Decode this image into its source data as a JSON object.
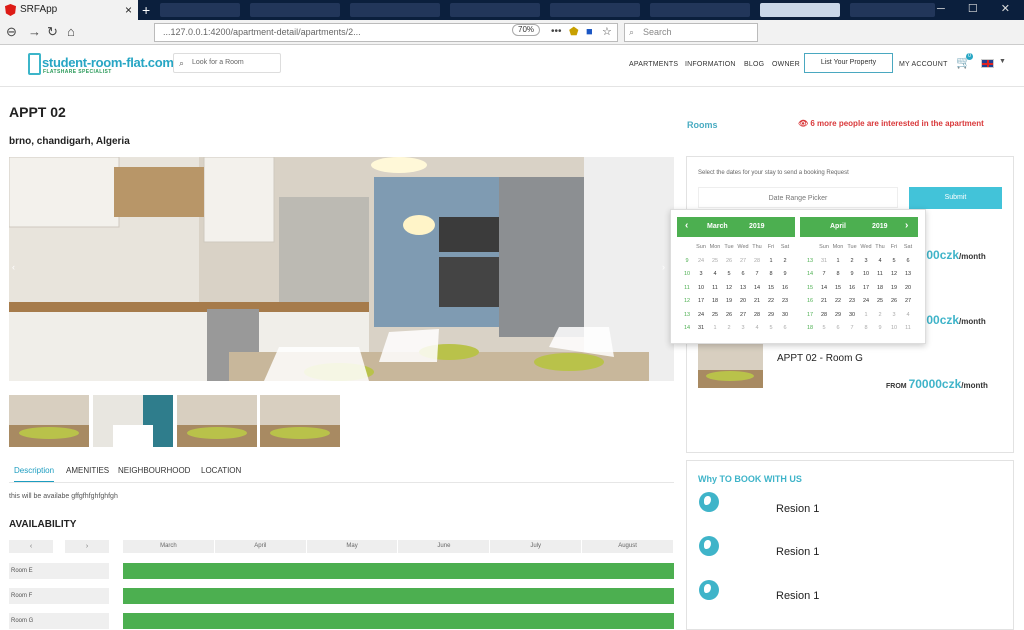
{
  "browser": {
    "tab_title": "SRFApp",
    "tab_close": "×",
    "new_tab": "+",
    "win_buttons": "─ ☐ ✕",
    "url": "...127.0.0.1:4200/apartment-detail/apartments/2...",
    "zoom": "70%",
    "menu_dots": "•••",
    "search_placeholder": "Search"
  },
  "header": {
    "logo": "student-room-flat.com",
    "logo_sub": "FLATSHARE SPECIALIST",
    "search_placeholder": "Look for a Room",
    "nav": [
      "APARTMENTS",
      "INFORMATION",
      "BLOG",
      "OWNER"
    ],
    "list_property": "List Your Property",
    "my_account": "MY ACCOUNT",
    "cart_count": "0"
  },
  "listing": {
    "title": "APPT 02",
    "address": "brno, chandigarh, Algeria",
    "tabs": [
      "Description",
      "AMENITIES",
      "NEIGHBOURHOOD",
      "LOCATION"
    ],
    "description": "this will be availabe gffgfhfghfghfgh"
  },
  "availability": {
    "heading": "AVAILABILITY",
    "prev": "‹",
    "next": "›",
    "months": [
      "March",
      "April",
      "May",
      "June",
      "July",
      "August"
    ],
    "rooms": [
      "Room E",
      "Room F",
      "Room G"
    ]
  },
  "sidebar": {
    "rooms_label": "Rooms",
    "interest": "👁 6 more people are interested in the apartment",
    "hint": "Select the dates for your stay to send a booking Request",
    "date_picker": "Date Range Picker",
    "submit": "Submit",
    "prices": [
      "5000czk",
      "0000czk"
    ],
    "room_g": {
      "name": "APPT 02 - Room G",
      "from": "FROM",
      "price": "70000czk",
      "per": "/month"
    },
    "per_month": "/month"
  },
  "why": {
    "heading": "Why TO BOOK WITH US",
    "reasons": [
      "Resion 1",
      "Resion 1",
      "Resion 1"
    ]
  },
  "calendar": {
    "left": {
      "month": "March",
      "year": "2019",
      "prev": "‹"
    },
    "right": {
      "month": "April",
      "year": "2019",
      "next": "›"
    },
    "days": [
      "",
      "Sun",
      "Mon",
      "Tue",
      "Wed",
      "Thu",
      "Fri",
      "Sat"
    ],
    "march": [
      [
        "9",
        "24",
        "25",
        "26",
        "27",
        "28",
        "1",
        "2"
      ],
      [
        "10",
        "3",
        "4",
        "5",
        "6",
        "7",
        "8",
        "9"
      ],
      [
        "11",
        "10",
        "11",
        "12",
        "13",
        "14",
        "15",
        "16"
      ],
      [
        "12",
        "17",
        "18",
        "19",
        "20",
        "21",
        "22",
        "23"
      ],
      [
        "13",
        "24",
        "25",
        "26",
        "27",
        "28",
        "29",
        "30"
      ],
      [
        "14",
        "31",
        "1",
        "2",
        "3",
        "4",
        "5",
        "6"
      ]
    ],
    "april": [
      [
        "13",
        "31",
        "1",
        "2",
        "3",
        "4",
        "5",
        "6"
      ],
      [
        "14",
        "7",
        "8",
        "9",
        "10",
        "11",
        "12",
        "13"
      ],
      [
        "15",
        "14",
        "15",
        "16",
        "17",
        "18",
        "19",
        "20"
      ],
      [
        "16",
        "21",
        "22",
        "23",
        "24",
        "25",
        "26",
        "27"
      ],
      [
        "17",
        "28",
        "29",
        "30",
        "1",
        "2",
        "3",
        "4"
      ],
      [
        "18",
        "5",
        "6",
        "7",
        "8",
        "9",
        "10",
        "11"
      ]
    ]
  },
  "colors": {
    "accent": "#42c3d9",
    "green": "#4caf50",
    "red": "#d9383a"
  }
}
